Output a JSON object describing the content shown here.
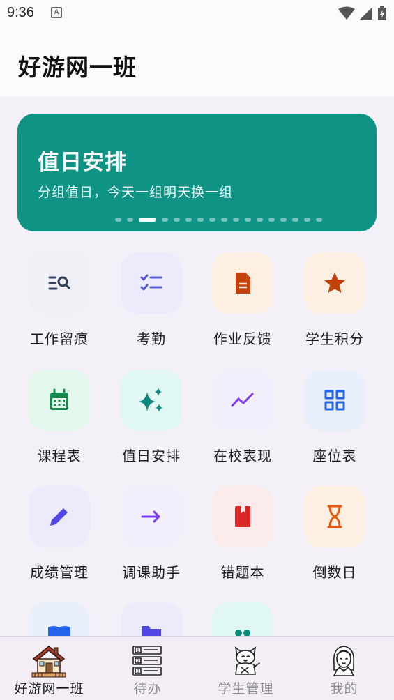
{
  "status_bar": {
    "time": "9:36",
    "notification_icon": "a-badge-icon",
    "icons": [
      "wifi-icon",
      "signal-icon",
      "battery-charging-icon"
    ]
  },
  "header": {
    "title": "好游网一班"
  },
  "banner": {
    "title": "值日安排",
    "subtitle": "分组值日，今天一组明天换一组",
    "page_count": 17,
    "active_index": 2,
    "background": "#0e9385"
  },
  "grid": {
    "items": [
      {
        "label": "工作留痕",
        "icon": "list-search-icon",
        "bg": "#eef0f6",
        "fg": "#34415a"
      },
      {
        "label": "考勤",
        "icon": "checklist-icon",
        "bg": "#ebebfb",
        "fg": "#5b5bd6"
      },
      {
        "label": "作业反馈",
        "icon": "document-icon",
        "bg": "#fdf0e3",
        "fg": "#c2410c"
      },
      {
        "label": "学生积分",
        "icon": "star-icon",
        "bg": "#fdf0e3",
        "fg": "#c2410c"
      },
      {
        "label": "课程表",
        "icon": "calendar-icon",
        "bg": "#e3f7ec",
        "fg": "#118a4b"
      },
      {
        "label": "值日安排",
        "icon": "sparkle-icon",
        "bg": "#e0f7f4",
        "fg": "#0e8a7d"
      },
      {
        "label": "在校表现",
        "icon": "trend-line-icon",
        "bg": "#f2eefb",
        "fg": "#7c3aed"
      },
      {
        "label": "座位表",
        "icon": "grid-icon",
        "bg": "#e9f0fb",
        "fg": "#2563eb"
      },
      {
        "label": "成绩管理",
        "icon": "pencil-icon",
        "bg": "#ebebfb",
        "fg": "#4f46e5"
      },
      {
        "label": "调课助手",
        "icon": "arrow-right-icon",
        "bg": "#f2eefb",
        "fg": "#7c3aed"
      },
      {
        "label": "错题本",
        "icon": "book-icon",
        "bg": "#fcebeb",
        "fg": "#dc2626"
      },
      {
        "label": "倒数日",
        "icon": "hourglass-icon",
        "bg": "#fdf0e3",
        "fg": "#ea580c"
      },
      {
        "label": "",
        "icon": "open-book-icon",
        "bg": "#e9f0fb",
        "fg": "#2563eb"
      },
      {
        "label": "",
        "icon": "folder-icon",
        "bg": "#ebebfb",
        "fg": "#4f46e5"
      },
      {
        "label": "",
        "icon": "dots-icon",
        "bg": "#e0f7f4",
        "fg": "#0e8a7d"
      }
    ]
  },
  "bottom_nav": {
    "items": [
      {
        "label": "好游网一班",
        "icon": "house-icon",
        "active": true
      },
      {
        "label": "待办",
        "icon": "numbered-list-icon",
        "active": false
      },
      {
        "label": "学生管理",
        "icon": "cat-student-icon",
        "active": false
      },
      {
        "label": "我的",
        "icon": "girl-avatar-icon",
        "active": false
      }
    ]
  }
}
